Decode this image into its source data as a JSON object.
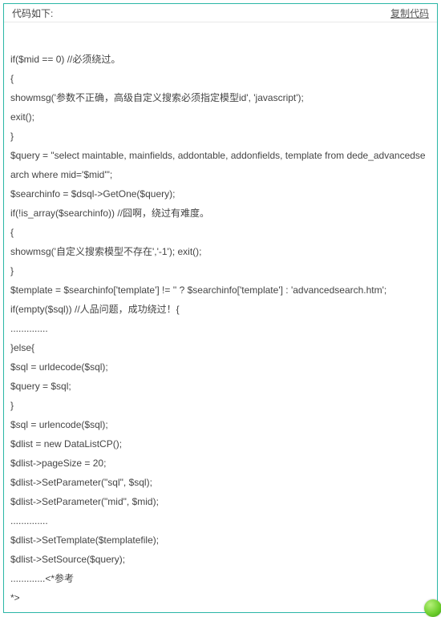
{
  "header": {
    "title": "代码如下:",
    "copy_label": "复制代码"
  },
  "code": {
    "lines": [
      "",
      "if($mid == 0) //必须绕过。",
      "{",
      "showmsg('参数不正确，高级自定义搜索必须指定模型id', 'javascript');",
      "exit();",
      "}",
      "$query = \"select maintable, mainfields, addontable, addonfields, template from dede_advancedsearch where mid='$mid'\";",
      "$searchinfo = $dsql->GetOne($query);",
      "if(!is_array($searchinfo)) //囧啊，绕过有难度。",
      "{",
      "showmsg('自定义搜索模型不存在','-1'); exit();",
      "}",
      "$template = $searchinfo['template'] != '' ? $searchinfo['template'] : 'advancedsearch.htm';",
      "if(empty($sql)) //人品问题，成功绕过！{",
      "..............",
      "}else{",
      "$sql = urldecode($sql);",
      "$query = $sql;",
      "}",
      "$sql = urlencode($sql);",
      "$dlist = new DataListCP();",
      "$dlist->pageSize = 20;",
      "$dlist->SetParameter(\"sql\", $sql);",
      "$dlist->SetParameter(\"mid\", $mid);",
      "..............",
      "$dlist->SetTemplate($templatefile);",
      "$dlist->SetSource($query);",
      ".............<*参考",
      "*>"
    ]
  }
}
